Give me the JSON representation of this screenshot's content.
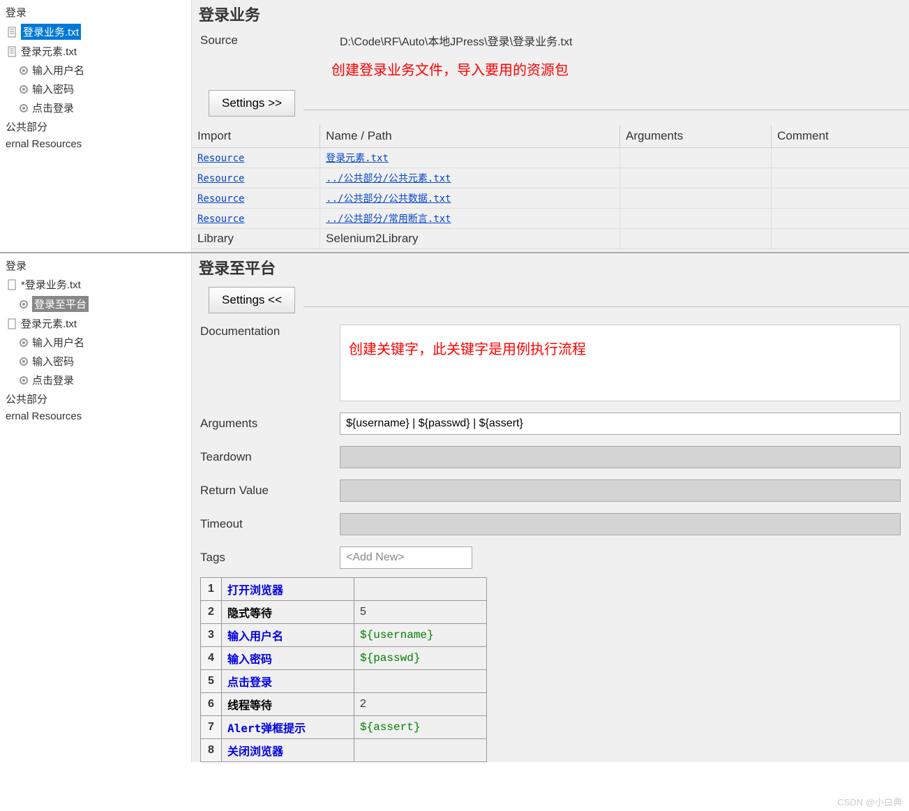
{
  "top": {
    "sidebar": {
      "root": "登录",
      "items": [
        {
          "label": "登录业务.txt",
          "type": "file",
          "selected": true
        },
        {
          "label": "登录元素.txt",
          "type": "file"
        },
        {
          "label": "输入用户名",
          "type": "gear"
        },
        {
          "label": "输入密码",
          "type": "gear"
        },
        {
          "label": "点击登录",
          "type": "gear"
        }
      ],
      "public": "公共部分",
      "external": "ernal Resources"
    },
    "header": "登录业务",
    "source_label": "Source",
    "source_value": "D:\\Code\\RF\\Auto\\本地JPress\\登录\\登录业务.txt",
    "red_note": "创建登录业务文件，导入要用的资源包",
    "settings_btn": "Settings >>",
    "cols": {
      "import": "Import",
      "name": "Name / Path",
      "args": "Arguments",
      "comment": "Comment"
    },
    "rows": [
      {
        "import": "Resource",
        "name": "登录元素.txt"
      },
      {
        "import": "Resource",
        "name": "../公共部分/公共元素.txt"
      },
      {
        "import": "Resource",
        "name": "../公共部分/公共数据.txt"
      },
      {
        "import": "Resource",
        "name": "../公共部分/常用断言.txt"
      }
    ],
    "library_row": {
      "import": "Library",
      "name": "Selenium2Library"
    }
  },
  "bottom": {
    "sidebar": {
      "root": "登录",
      "items": [
        {
          "label": "*登录业务.txt",
          "type": "file"
        },
        {
          "label": "登录至平台",
          "type": "gear",
          "selected": true
        },
        {
          "label": "登录元素.txt",
          "type": "file"
        },
        {
          "label": "输入用户名",
          "type": "gear"
        },
        {
          "label": "输入密码",
          "type": "gear"
        },
        {
          "label": "点击登录",
          "type": "gear"
        }
      ],
      "public": "公共部分",
      "external": "ernal Resources"
    },
    "header": "登录至平台",
    "settings_btn": "Settings <<",
    "doc_label": "Documentation",
    "red_note": "创建关键字，此关键字是用例执行流程",
    "fields": {
      "arguments_label": "Arguments",
      "arguments_value": "${username} | ${passwd} | ${assert}",
      "teardown_label": "Teardown",
      "return_label": "Return Value",
      "timeout_label": "Timeout",
      "tags_label": "Tags",
      "tags_placeholder": "<Add New>"
    },
    "steps": [
      {
        "n": "1",
        "kw": "打开浏览器",
        "kw_class": "blue",
        "arg": ""
      },
      {
        "n": "2",
        "kw": "隐式等待",
        "kw_class": "black",
        "arg": "5"
      },
      {
        "n": "3",
        "kw": "输入用户名",
        "kw_class": "blue",
        "arg": "${username}",
        "arg_green": true
      },
      {
        "n": "4",
        "kw": "输入密码",
        "kw_class": "blue",
        "arg": "${passwd}",
        "arg_green": true
      },
      {
        "n": "5",
        "kw": "点击登录",
        "kw_class": "blue",
        "arg": ""
      },
      {
        "n": "6",
        "kw": "线程等待",
        "kw_class": "black",
        "arg": "2"
      },
      {
        "n": "7",
        "kw": "Alert弹框提示",
        "kw_class": "blue",
        "arg": "${assert}",
        "arg_green": true
      },
      {
        "n": "8",
        "kw": "关闭浏览器",
        "kw_class": "blue",
        "arg": ""
      }
    ]
  },
  "watermark": "CSDN @小白典"
}
